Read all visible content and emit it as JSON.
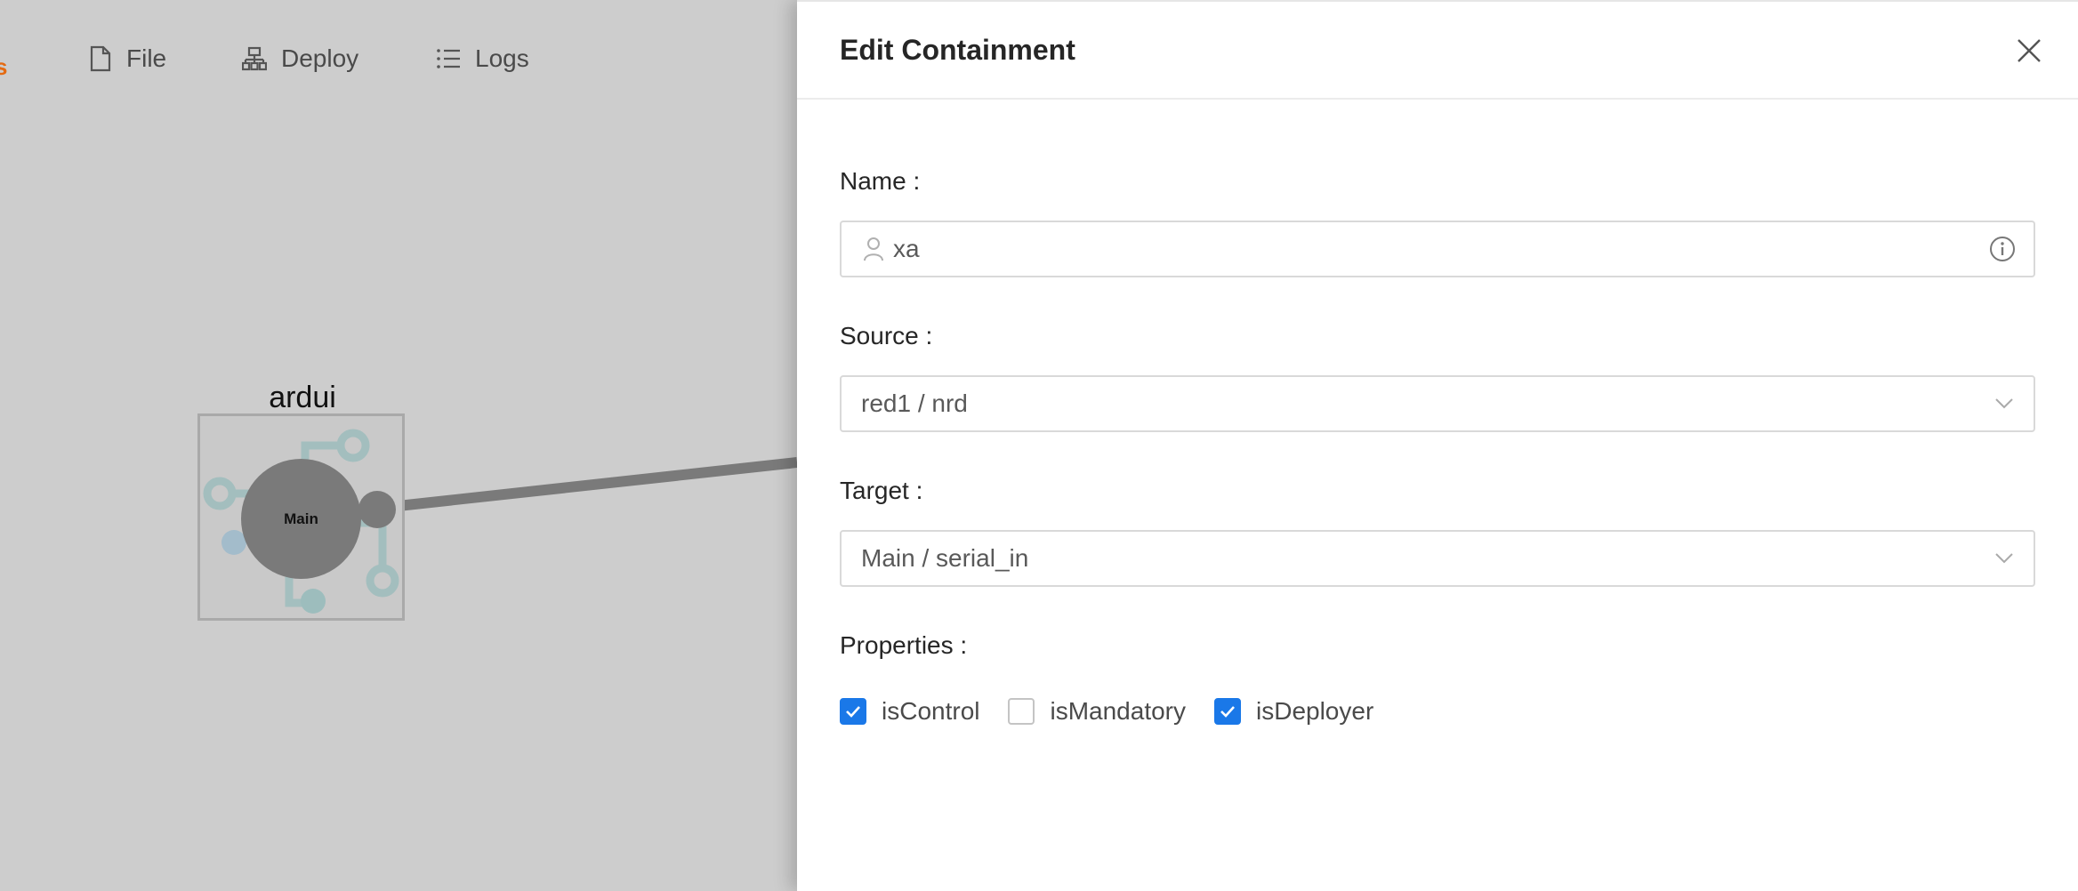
{
  "menu": {
    "brand_fragment": "s",
    "file_label": "File",
    "deploy_label": "Deploy",
    "logs_label": "Logs"
  },
  "canvas": {
    "node_title": "ardui",
    "port_label": "Main"
  },
  "drawer": {
    "title": "Edit Containment",
    "name": {
      "label": "Name :",
      "value": "xa"
    },
    "source": {
      "label": "Source :",
      "value": "red1 / nrd"
    },
    "target": {
      "label": "Target :",
      "value": "Main / serial_in"
    },
    "properties": {
      "label": "Properties :",
      "items": [
        {
          "label": "isControl",
          "checked": true
        },
        {
          "label": "isMandatory",
          "checked": false
        },
        {
          "label": "isDeployer",
          "checked": true
        }
      ]
    }
  },
  "colors": {
    "accent": "#1a78e8",
    "brand": "#e46a12",
    "canvas_bg": "#cdcdcd"
  }
}
